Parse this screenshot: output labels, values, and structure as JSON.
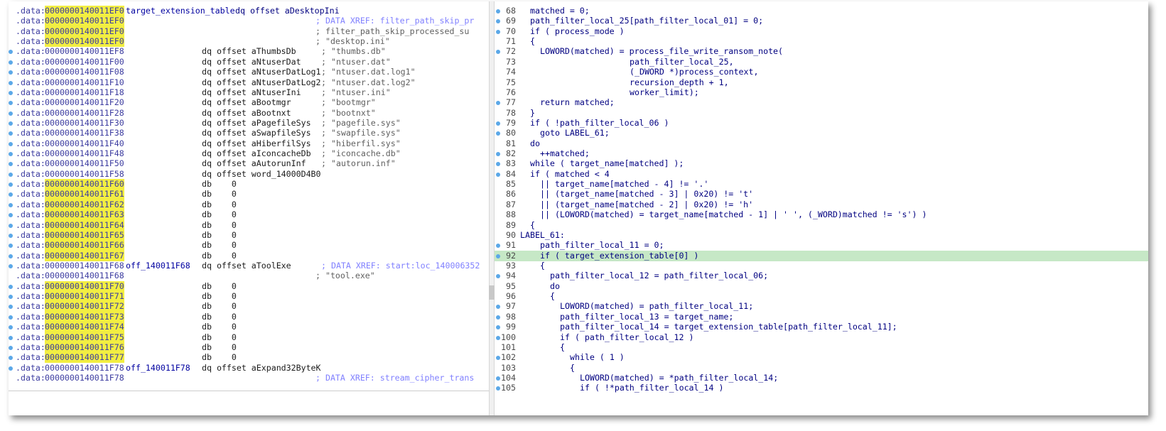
{
  "disasm": {
    "rows": [
      {
        "seg": ".data:",
        "addr": "0000000140011EF0",
        "hl": true,
        "label": "target_extension_table",
        "op": "dq offset aDesktopIni",
        "cmt": "",
        "dot": false
      },
      {
        "seg": ".data:",
        "addr": "0000000140011EF0",
        "hl": true,
        "label": "",
        "op": "",
        "cmt": "; DATA XREF: filter_path_skip_pr",
        "dot": false
      },
      {
        "seg": ".data:",
        "addr": "0000000140011EF0",
        "hl": true,
        "label": "",
        "op": "",
        "cmt": "; filter_path_skip_processed_su",
        "dot": false
      },
      {
        "seg": ".data:",
        "addr": "0000000140011EF0",
        "hl": true,
        "label": "",
        "op": "",
        "cmt": "; \"desktop.ini\"",
        "dot": false
      },
      {
        "seg": ".data:",
        "addr": "0000000140011EF8",
        "hl": false,
        "label": "",
        "op": "dq offset aThumbsDb",
        "cmt": "; \"thumbs.db\"",
        "dot": true
      },
      {
        "seg": ".data:",
        "addr": "0000000140011F00",
        "hl": false,
        "label": "",
        "op": "dq offset aNtuserDat",
        "cmt": "; \"ntuser.dat\"",
        "dot": true
      },
      {
        "seg": ".data:",
        "addr": "0000000140011F08",
        "hl": false,
        "label": "",
        "op": "dq offset aNtuserDatLog1",
        "cmt": "; \"ntuser.dat.log1\"",
        "dot": true
      },
      {
        "seg": ".data:",
        "addr": "0000000140011F10",
        "hl": false,
        "label": "",
        "op": "dq offset aNtuserDatLog2",
        "cmt": "; \"ntuser.dat.log2\"",
        "dot": true
      },
      {
        "seg": ".data:",
        "addr": "0000000140011F18",
        "hl": false,
        "label": "",
        "op": "dq offset aNtuserIni",
        "cmt": "; \"ntuser.ini\"",
        "dot": true
      },
      {
        "seg": ".data:",
        "addr": "0000000140011F20",
        "hl": false,
        "label": "",
        "op": "dq offset aBootmgr",
        "cmt": "; \"bootmgr\"",
        "dot": true
      },
      {
        "seg": ".data:",
        "addr": "0000000140011F28",
        "hl": false,
        "label": "",
        "op": "dq offset aBootnxt",
        "cmt": "; \"bootnxt\"",
        "dot": true
      },
      {
        "seg": ".data:",
        "addr": "0000000140011F30",
        "hl": false,
        "label": "",
        "op": "dq offset aPagefileSys",
        "cmt": "; \"pagefile.sys\"",
        "dot": true
      },
      {
        "seg": ".data:",
        "addr": "0000000140011F38",
        "hl": false,
        "label": "",
        "op": "dq offset aSwapfileSys",
        "cmt": "; \"swapfile.sys\"",
        "dot": true
      },
      {
        "seg": ".data:",
        "addr": "0000000140011F40",
        "hl": false,
        "label": "",
        "op": "dq offset aHiberfilSys",
        "cmt": "; \"hiberfil.sys\"",
        "dot": true
      },
      {
        "seg": ".data:",
        "addr": "0000000140011F48",
        "hl": false,
        "label": "",
        "op": "dq offset aIconcacheDb",
        "cmt": "; \"iconcache.db\"",
        "dot": true
      },
      {
        "seg": ".data:",
        "addr": "0000000140011F50",
        "hl": false,
        "label": "",
        "op": "dq offset aAutorunInf",
        "cmt": "; \"autorun.inf\"",
        "dot": true
      },
      {
        "seg": ".data:",
        "addr": "0000000140011F58",
        "hl": false,
        "label": "",
        "op": "dq offset word_14000D4B0",
        "cmt": "",
        "dot": true
      },
      {
        "seg": ".data:",
        "addr": "0000000140011F60",
        "hl": true,
        "label": "",
        "op": "db    0",
        "cmt": "",
        "dot": true
      },
      {
        "seg": ".data:",
        "addr": "0000000140011F61",
        "hl": true,
        "label": "",
        "op": "db    0",
        "cmt": "",
        "dot": true
      },
      {
        "seg": ".data:",
        "addr": "0000000140011F62",
        "hl": true,
        "label": "",
        "op": "db    0",
        "cmt": "",
        "dot": true
      },
      {
        "seg": ".data:",
        "addr": "0000000140011F63",
        "hl": true,
        "label": "",
        "op": "db    0",
        "cmt": "",
        "dot": true
      },
      {
        "seg": ".data:",
        "addr": "0000000140011F64",
        "hl": true,
        "label": "",
        "op": "db    0",
        "cmt": "",
        "dot": true
      },
      {
        "seg": ".data:",
        "addr": "0000000140011F65",
        "hl": true,
        "label": "",
        "op": "db    0",
        "cmt": "",
        "dot": true
      },
      {
        "seg": ".data:",
        "addr": "0000000140011F66",
        "hl": true,
        "label": "",
        "op": "db    0",
        "cmt": "",
        "dot": true
      },
      {
        "seg": ".data:",
        "addr": "0000000140011F67",
        "hl": true,
        "label": "",
        "op": "db    0",
        "cmt": "",
        "dot": true
      },
      {
        "seg": ".data:",
        "addr": "0000000140011F68",
        "hl": false,
        "label": "off_140011F68",
        "op": "dq offset aToolExe",
        "cmt": "; DATA XREF: start:loc_140006352",
        "dot": true
      },
      {
        "seg": ".data:",
        "addr": "0000000140011F68",
        "hl": false,
        "label": "",
        "op": "",
        "cmt": "; \"tool.exe\"",
        "dot": false
      },
      {
        "seg": ".data:",
        "addr": "0000000140011F70",
        "hl": true,
        "label": "",
        "op": "db    0",
        "cmt": "",
        "dot": true
      },
      {
        "seg": ".data:",
        "addr": "0000000140011F71",
        "hl": true,
        "label": "",
        "op": "db    0",
        "cmt": "",
        "dot": true
      },
      {
        "seg": ".data:",
        "addr": "0000000140011F72",
        "hl": true,
        "label": "",
        "op": "db    0",
        "cmt": "",
        "dot": true
      },
      {
        "seg": ".data:",
        "addr": "0000000140011F73",
        "hl": true,
        "label": "",
        "op": "db    0",
        "cmt": "",
        "dot": true
      },
      {
        "seg": ".data:",
        "addr": "0000000140011F74",
        "hl": true,
        "label": "",
        "op": "db    0",
        "cmt": "",
        "dot": true
      },
      {
        "seg": ".data:",
        "addr": "0000000140011F75",
        "hl": true,
        "label": "",
        "op": "db    0",
        "cmt": "",
        "dot": true
      },
      {
        "seg": ".data:",
        "addr": "0000000140011F76",
        "hl": true,
        "label": "",
        "op": "db    0",
        "cmt": "",
        "dot": true
      },
      {
        "seg": ".data:",
        "addr": "0000000140011F77",
        "hl": true,
        "label": "",
        "op": "db    0",
        "cmt": "",
        "dot": true
      },
      {
        "seg": ".data:",
        "addr": "0000000140011F78",
        "hl": false,
        "label": "off_140011F78",
        "op": "dq offset aExpand32ByteK",
        "cmt": "",
        "dot": true
      },
      {
        "seg": ".data:",
        "addr": "0000000140011F78",
        "hl": false,
        "label": "",
        "op": "",
        "cmt": "; DATA XREF: stream_cipher_trans",
        "dot": false
      }
    ]
  },
  "decomp": {
    "highlight_line": "92",
    "rows": [
      {
        "n": "68",
        "dot": true,
        "indent": 0,
        "code": "matched = 0;"
      },
      {
        "n": "69",
        "dot": true,
        "indent": 0,
        "code": "path_filter_local_25[path_filter_local_01] = 0;"
      },
      {
        "n": "70",
        "dot": true,
        "indent": 0,
        "code": "if ( process_mode )"
      },
      {
        "n": "71",
        "dot": false,
        "indent": 0,
        "code": "{"
      },
      {
        "n": "72",
        "dot": true,
        "indent": 1,
        "code": "LOWORD(matched) = process_file_write_ransom_note("
      },
      {
        "n": "73",
        "dot": false,
        "indent": 10,
        "code": "path_filter_local_25,"
      },
      {
        "n": "74",
        "dot": false,
        "indent": 10,
        "code": "(_DWORD *)process_context,"
      },
      {
        "n": "75",
        "dot": false,
        "indent": 10,
        "code": "recursion_depth + 1,"
      },
      {
        "n": "76",
        "dot": false,
        "indent": 10,
        "code": "worker_limit);"
      },
      {
        "n": "77",
        "dot": true,
        "indent": 1,
        "code": "return matched;"
      },
      {
        "n": "78",
        "dot": false,
        "indent": 0,
        "code": "}"
      },
      {
        "n": "79",
        "dot": true,
        "indent": 0,
        "code": "if ( !path_filter_local_06 )"
      },
      {
        "n": "80",
        "dot": true,
        "indent": 1,
        "code": "goto LABEL_61;"
      },
      {
        "n": "81",
        "dot": false,
        "indent": 0,
        "code": "do"
      },
      {
        "n": "82",
        "dot": true,
        "indent": 1,
        "code": "++matched;"
      },
      {
        "n": "83",
        "dot": true,
        "indent": 0,
        "code": "while ( target_name[matched] );"
      },
      {
        "n": "84",
        "dot": true,
        "indent": 0,
        "code": "if ( matched < 4"
      },
      {
        "n": "85",
        "dot": false,
        "indent": 1,
        "code": "|| target_name[matched - 4] != '.'"
      },
      {
        "n": "86",
        "dot": false,
        "indent": 1,
        "code": "|| (target_name[matched - 3] | 0x20) != 't'"
      },
      {
        "n": "87",
        "dot": false,
        "indent": 1,
        "code": "|| (target_name[matched - 2] | 0x20) != 'h'"
      },
      {
        "n": "88",
        "dot": false,
        "indent": 1,
        "code": "|| (LOWORD(matched) = target_name[matched - 1] | ' ', (_WORD)matched != 's') )"
      },
      {
        "n": "89",
        "dot": false,
        "indent": 0,
        "code": "{"
      },
      {
        "n": "90",
        "dot": false,
        "indent": -1,
        "code": "LABEL_61:"
      },
      {
        "n": "91",
        "dot": true,
        "indent": 1,
        "code": "path_filter_local_11 = 0;"
      },
      {
        "n": "92",
        "dot": true,
        "indent": 1,
        "code": "if ( target_extension_table[0] )"
      },
      {
        "n": "93",
        "dot": false,
        "indent": 1,
        "code": "{"
      },
      {
        "n": "94",
        "dot": true,
        "indent": 2,
        "code": "path_filter_local_12 = path_filter_local_06;"
      },
      {
        "n": "95",
        "dot": false,
        "indent": 2,
        "code": "do"
      },
      {
        "n": "96",
        "dot": false,
        "indent": 2,
        "code": "{"
      },
      {
        "n": "97",
        "dot": true,
        "indent": 3,
        "code": "LOWORD(matched) = path_filter_local_11;"
      },
      {
        "n": "98",
        "dot": true,
        "indent": 3,
        "code": "path_filter_local_13 = target_name;"
      },
      {
        "n": "99",
        "dot": true,
        "indent": 3,
        "code": "path_filter_local_14 = target_extension_table[path_filter_local_11];"
      },
      {
        "n": "100",
        "dot": true,
        "indent": 3,
        "code": "if ( path_filter_local_12 )"
      },
      {
        "n": "101",
        "dot": false,
        "indent": 3,
        "code": "{"
      },
      {
        "n": "102",
        "dot": true,
        "indent": 4,
        "code": "while ( 1 )"
      },
      {
        "n": "103",
        "dot": false,
        "indent": 4,
        "code": "{"
      },
      {
        "n": "104",
        "dot": true,
        "indent": 5,
        "code": "LOWORD(matched) = *path_filter_local_14;"
      },
      {
        "n": "105",
        "dot": true,
        "indent": 5,
        "code": "if ( !*path_filter_local_14 )"
      }
    ]
  }
}
